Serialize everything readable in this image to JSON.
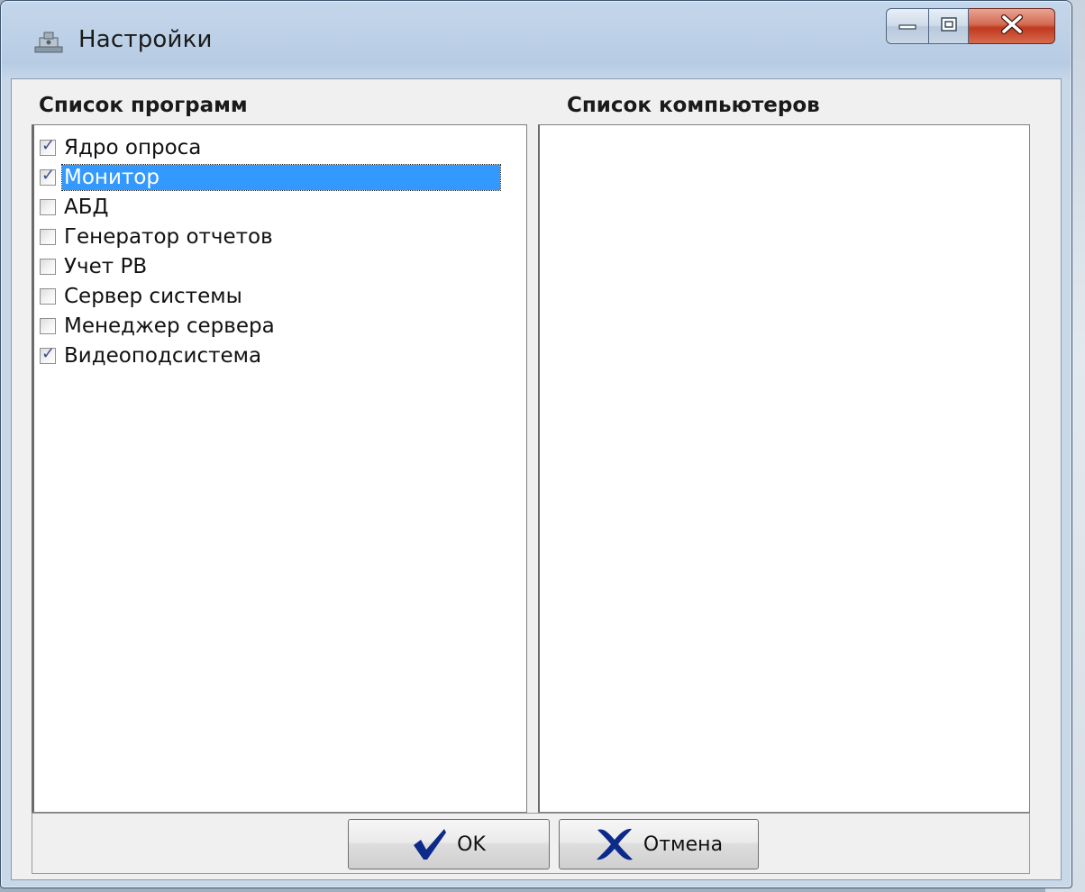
{
  "window": {
    "title": "Настройки"
  },
  "programs": {
    "header": "Список программ",
    "items": [
      {
        "label": "Ядро опроса",
        "checked": true
      },
      {
        "label": "Монитор",
        "checked": true,
        "selected": true
      },
      {
        "label": "АБД",
        "checked": false
      },
      {
        "label": "Генератор отчетов",
        "checked": false
      },
      {
        "label": "Учет РВ",
        "checked": false
      },
      {
        "label": "Сервер системы",
        "checked": false
      },
      {
        "label": "Менеджер сервера",
        "checked": false
      },
      {
        "label": "Видеоподсистема",
        "checked": true
      }
    ]
  },
  "computers": {
    "header": "Список компьютеров",
    "items": []
  },
  "buttons": {
    "ok_label": "OK",
    "cancel_label": "Отмена"
  },
  "icons": {
    "title": "settings-window-icon",
    "ok": "checkmark-icon",
    "cancel": "cross-icon",
    "minimize": "minimize-icon",
    "maximize": "maximize-icon",
    "close": "close-icon"
  },
  "colors": {
    "selection": "#3399ff",
    "icon_blue": "#0b2a8a",
    "close_red": "#c0391f"
  }
}
